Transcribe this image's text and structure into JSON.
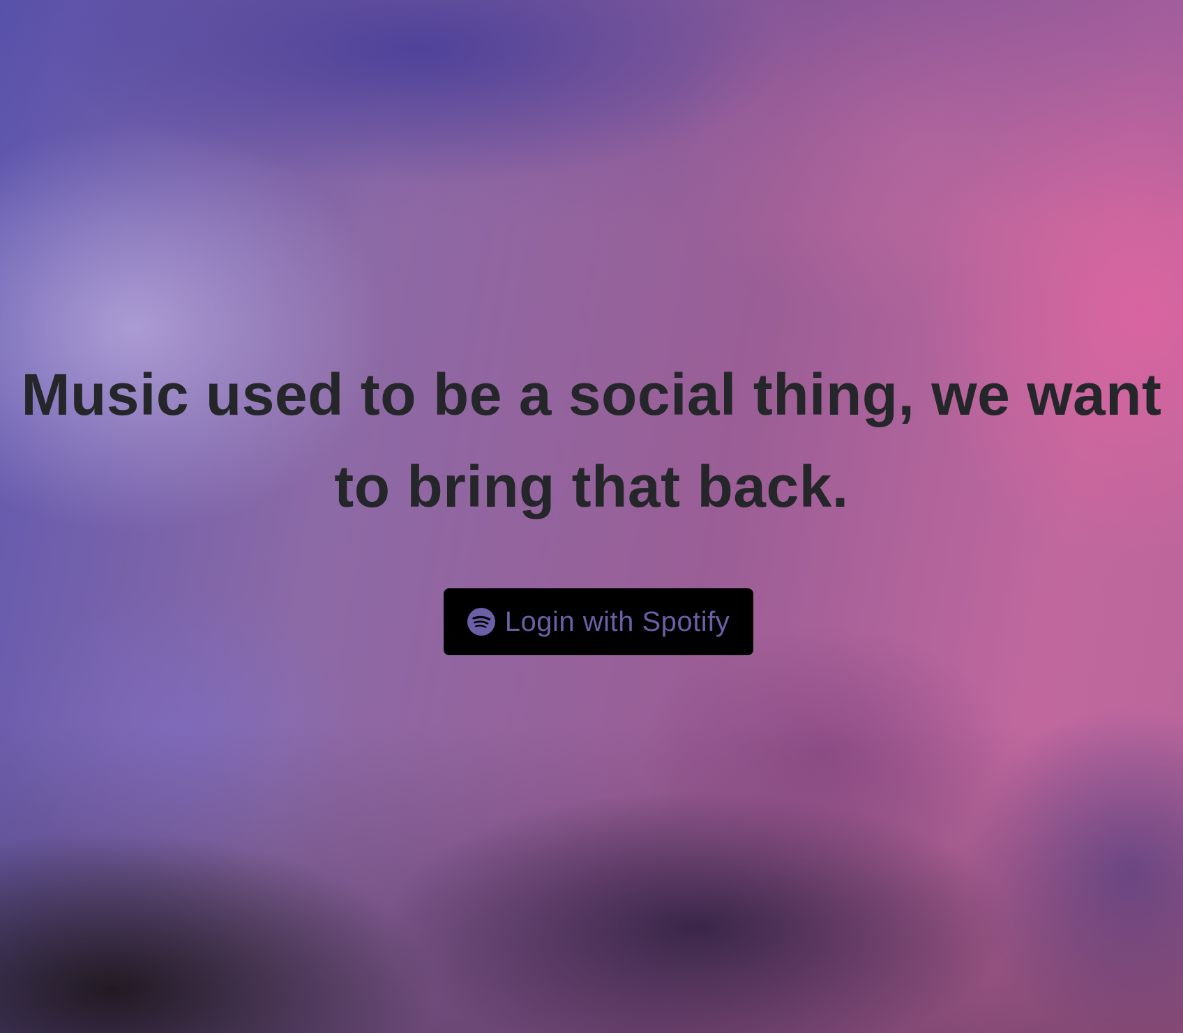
{
  "hero": {
    "headline_line1": "Music used to be a social thing, we want",
    "headline_line2": "to bring that back."
  },
  "login": {
    "label": "Login with Spotify",
    "icon": "spotify-icon"
  },
  "colors": {
    "button_bg": "#000000",
    "button_text": "#6b5fa7",
    "headline_text": "#25262a"
  }
}
